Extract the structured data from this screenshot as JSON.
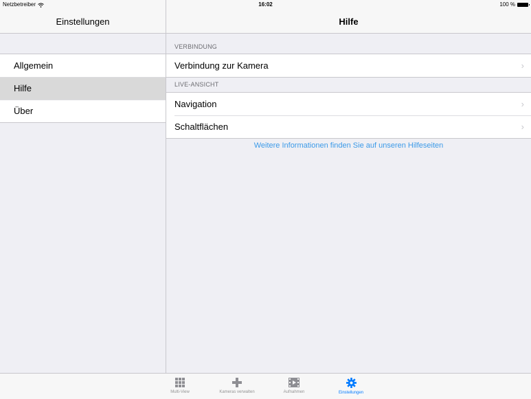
{
  "status": {
    "carrier": "Netzbetreiber",
    "time": "16:02",
    "battery": "100 %"
  },
  "master": {
    "title": "Einstellungen",
    "items": [
      {
        "label": "Allgemein"
      },
      {
        "label": "Hilfe",
        "selected": true
      },
      {
        "label": "Über"
      }
    ]
  },
  "detail": {
    "title": "Hilfe",
    "sections": [
      {
        "header": "VERBINDUNG",
        "rows": [
          "Verbindung zur Kamera"
        ]
      },
      {
        "header": "LIVE-ANSICHT",
        "rows": [
          "Navigation",
          "Schaltflächen"
        ]
      }
    ],
    "help_link": "Weitere Informationen finden Sie auf unseren Hilfeseiten"
  },
  "tabbar": {
    "tabs": [
      {
        "label": "Multi-View",
        "icon": "grid-icon"
      },
      {
        "label": "Kameras verwalten",
        "icon": "plus-icon"
      },
      {
        "label": "Aufnahmen",
        "icon": "film-icon"
      },
      {
        "label": "Einstellungen",
        "icon": "gear-icon",
        "active": true
      }
    ]
  },
  "colors": {
    "accent": "#007aff",
    "link": "#3b9ae8",
    "selected_row": "#d9d9d9",
    "background": "#efeff4"
  }
}
